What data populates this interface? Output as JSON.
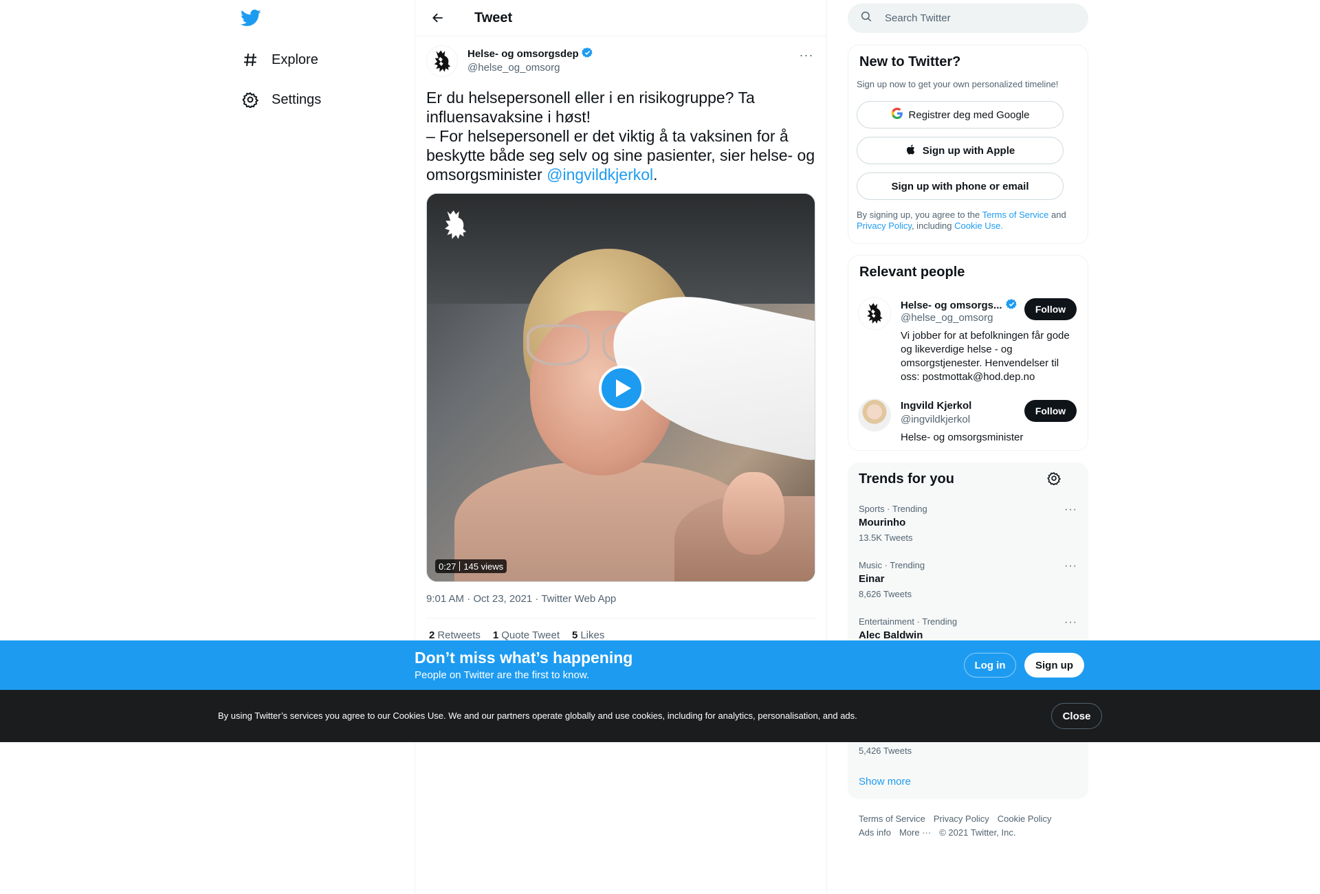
{
  "nav": {
    "logo": "twitter-bird",
    "items": [
      {
        "label": "Explore",
        "icon": "hashtag-icon"
      },
      {
        "label": "Settings",
        "icon": "gear-icon"
      }
    ]
  },
  "header": {
    "title": "Tweet"
  },
  "tweet": {
    "author_name": "Helse- og omsorgsdep",
    "author_handle": "@helse_og_omsorg",
    "verified": true,
    "text": "Er du helsepersonell eller i en risikogruppe? Ta influensavaksine i høst!\n– For helsepersonell er det viktig å ta vaksinen for å beskytte både seg selv og sine pasienter, sier helse- og omsorgsminister ",
    "mention": "@ingvildkjerkol",
    "text_end": ".",
    "video": {
      "duration": "0:27",
      "views": "145 views"
    },
    "meta": "9:01 AM · Oct 23, 2021 · Twitter Web App",
    "stats": {
      "retweets_count": "2",
      "retweets_label": "Retweets",
      "quotes_count": "1",
      "quotes_label": "Quote Tweet",
      "likes_count": "5",
      "likes_label": "Likes"
    }
  },
  "search": {
    "placeholder": "Search Twitter"
  },
  "signup": {
    "title": "New to Twitter?",
    "subtitle": "Sign up now to get your own personalized timeline!",
    "google": "Registrer deg med Google",
    "apple": "Sign up with Apple",
    "phone": "Sign up with phone or email",
    "legal_1": "By signing up, you agree to the ",
    "terms": "Terms of Service",
    "legal_2": " and ",
    "privacy": "Privacy Policy",
    "legal_3": ", including ",
    "cookie": "Cookie Use."
  },
  "relevant": {
    "title": "Relevant people",
    "people": [
      {
        "name": "Helse- og omsorgs...",
        "handle": "@helse_og_omsorg",
        "bio": "Vi jobber for at befolkningen får gode og likeverdige helse - og omsorgstjenester. Henvendelser til oss: postmottak@hod.dep.no",
        "follow": "Follow"
      },
      {
        "name": "Ingvild Kjerkol",
        "handle": "@ingvildkjerkol",
        "bio": "Helse- og omsorgsminister",
        "follow": "Follow"
      }
    ]
  },
  "trends": {
    "title": "Trends for you",
    "items": [
      {
        "category": "Sports · Trending",
        "name": "Mourinho",
        "count": "13.5K Tweets"
      },
      {
        "category": "Music · Trending",
        "name": "Einar",
        "count": "8,626 Tweets"
      },
      {
        "category": "Entertainment · Trending",
        "name": "Alec Baldwin",
        "count": ""
      }
    ],
    "hidden_count": "5,426 Tweets",
    "show_more": "Show more"
  },
  "footer": {
    "links": [
      "Terms of Service",
      "Privacy Policy",
      "Cookie Policy",
      "Ads info",
      "More ···"
    ],
    "copyright": "© 2021 Twitter, Inc."
  },
  "banner": {
    "title": "Don’t miss what’s happening",
    "subtitle": "People on Twitter are the first to know.",
    "login": "Log in",
    "signup": "Sign up"
  },
  "cookie_bar": {
    "text": "By using Twitter’s services you agree to our Cookies Use. We and our partners operate globally and use cookies, including for analytics, personalisation, and ads.",
    "close": "Close"
  },
  "colors": {
    "accent": "#1d9bf0",
    "text": "#0f1419",
    "muted": "#536471",
    "cookie_bg": "#1a1c1e"
  }
}
